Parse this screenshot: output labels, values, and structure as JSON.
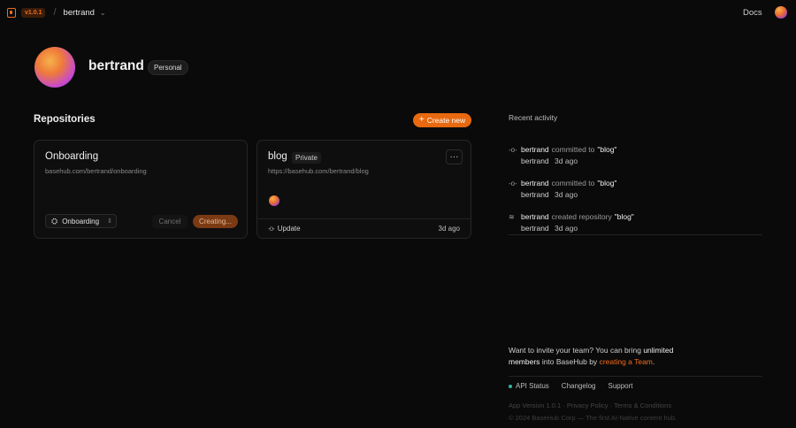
{
  "topbar": {
    "logo_icon": "basehub-logo-icon",
    "version": "v1.0.1",
    "separator": "/",
    "account_name": "bertrand",
    "chevron": "⌵",
    "docs_label": "Docs"
  },
  "profile": {
    "name": "bertrand",
    "badge": "Personal"
  },
  "repositories": {
    "title": "Repositories",
    "create_label": "Create new",
    "cards": [
      {
        "title": "Onboarding",
        "url": "basehub.com/bertrand/onboarding",
        "select_value": "Onboarding",
        "cancel_label": "Cancel",
        "creating_label": "Creating..."
      },
      {
        "title": "blog",
        "badge": "Private",
        "url": "https://basehub.com/bertrand/blog",
        "menu_label": "···",
        "update_label": "Update",
        "update_time": "3d ago"
      }
    ]
  },
  "activity": {
    "title": "Recent activity",
    "items": [
      {
        "icon": "commit-icon",
        "actor": "bertrand",
        "action": "committed to",
        "target": "\"blog\"",
        "user": "bertrand",
        "time": "3d ago"
      },
      {
        "icon": "commit-icon",
        "actor": "bertrand",
        "action": "committed to",
        "target": "\"blog\"",
        "user": "bertrand",
        "time": "3d ago"
      },
      {
        "icon": "layers-icon",
        "actor": "bertrand",
        "action": "created repository",
        "target": "\"blog\"",
        "user": "bertrand",
        "time": "3d ago"
      }
    ]
  },
  "invite": {
    "prefix": "Want to invite your team? You can bring",
    "strong": "unlimited members",
    "middle": "into BaseHub by",
    "link": "creating a Team",
    "suffix": "."
  },
  "footer": {
    "api_status": "API Status",
    "changelog": "Changelog",
    "support": "Support",
    "meta": "App Version 1.0.1 · Privacy Policy · Terms & Conditions",
    "copyright": "© 2024 BaseHub Corp — The first AI-Native content hub."
  },
  "colors": {
    "accent": "#e8690f",
    "background": "#0a0a0a",
    "status_ok": "#2fb7a0"
  }
}
